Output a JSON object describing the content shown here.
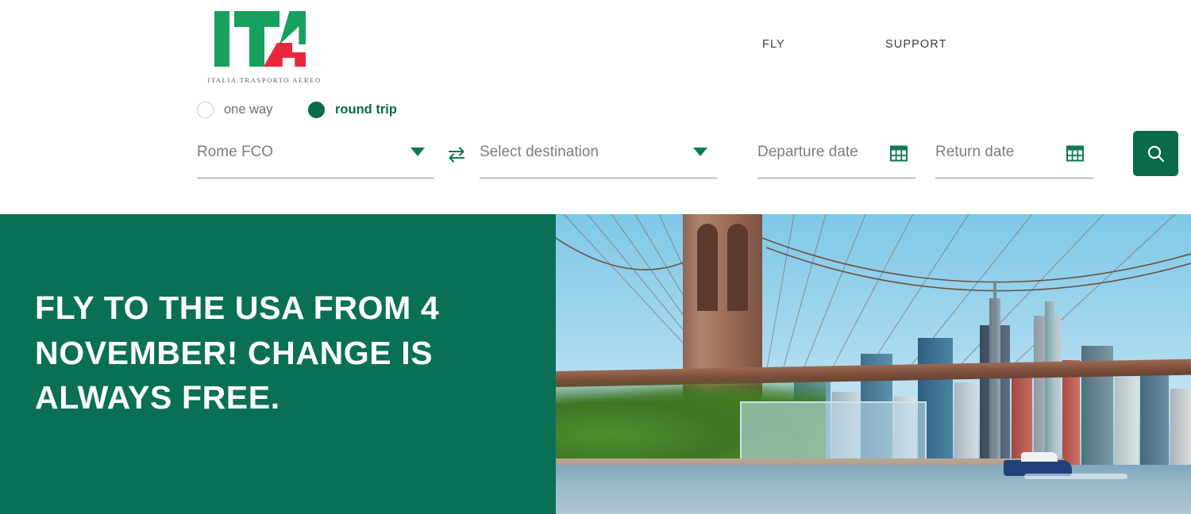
{
  "brand": {
    "logo_letters": "ITA",
    "tagline": "ITALIA TRASPORTO AEREO",
    "green": "#17a05e",
    "red": "#e8273f",
    "dark_green": "#0a6b48"
  },
  "nav": {
    "items": [
      {
        "label": "FLY",
        "name": "nav-item-fly"
      },
      {
        "label": "SUPPORT",
        "name": "nav-item-support"
      }
    ]
  },
  "trip_type": {
    "options": [
      {
        "label": "one way",
        "selected": false
      },
      {
        "label": "round trip",
        "selected": true
      }
    ],
    "selected": "round trip"
  },
  "search_form": {
    "origin": {
      "value": "Rome FCO",
      "placeholder": "Select origin"
    },
    "destination": {
      "value": "",
      "placeholder": "Select destination"
    },
    "departure_date": {
      "value": "",
      "placeholder": "Departure date"
    },
    "return_date": {
      "value": "",
      "placeholder": "Return date"
    },
    "swap_icon": "swap-arrows-icon",
    "calendar_icon": "calendar-icon",
    "search_icon": "search-icon",
    "search_button_label": ""
  },
  "hero": {
    "headline": "Fly to the USA from 4 November! Change is always free.",
    "panel_color": "#0a7055",
    "image_alt": "Brooklyn Bridge and Manhattan skyline"
  }
}
